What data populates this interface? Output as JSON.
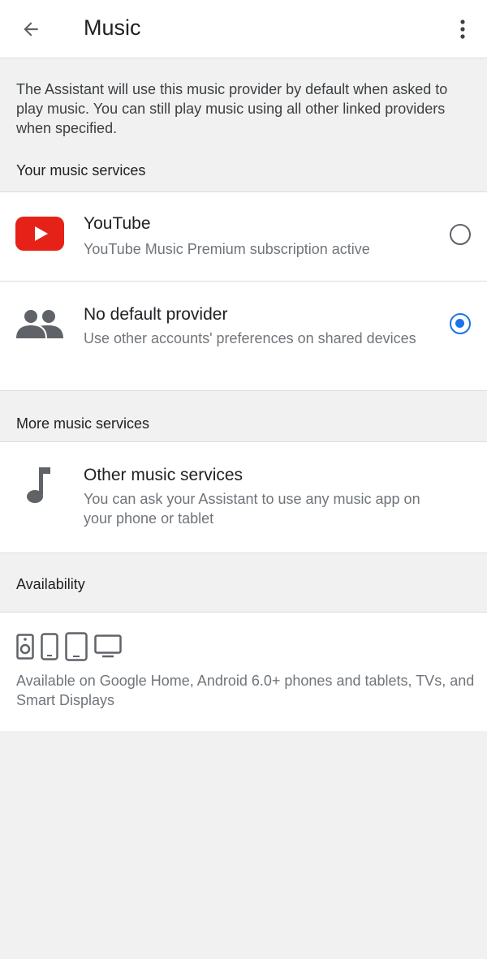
{
  "appbar": {
    "title": "Music",
    "back_icon": "arrow-back-icon",
    "more_icon": "more-vert-icon"
  },
  "info": {
    "text": "The Assistant will use this music provider by default when asked to play music. You can still play music using all other linked providers when specified."
  },
  "your_services": {
    "header": "Your music services",
    "items": [
      {
        "title": "YouTube",
        "subtitle": "YouTube Music Premium subscription active",
        "icon": "youtube-logo-icon",
        "selected": false
      },
      {
        "title": "No default provider",
        "subtitle": "Use other accounts' preferences on shared devices",
        "icon": "people-icon",
        "selected": true
      }
    ]
  },
  "more_services": {
    "header": "More music services",
    "item": {
      "title": "Other music services",
      "subtitle": "You can ask your Assistant to use any music app on your phone or tablet",
      "icon": "music-note-icon"
    }
  },
  "availability": {
    "header": "Availability",
    "icons": [
      "speaker-icon",
      "phone-icon",
      "tablet-icon",
      "tv-icon"
    ],
    "text": "Available on Google Home, Android 6.0+ phones and tablets, TVs, and Smart Displays"
  },
  "colors": {
    "accent": "#1a73e8",
    "youtube_red": "#e62117",
    "background": "#f1f1f1",
    "surface": "#ffffff"
  }
}
